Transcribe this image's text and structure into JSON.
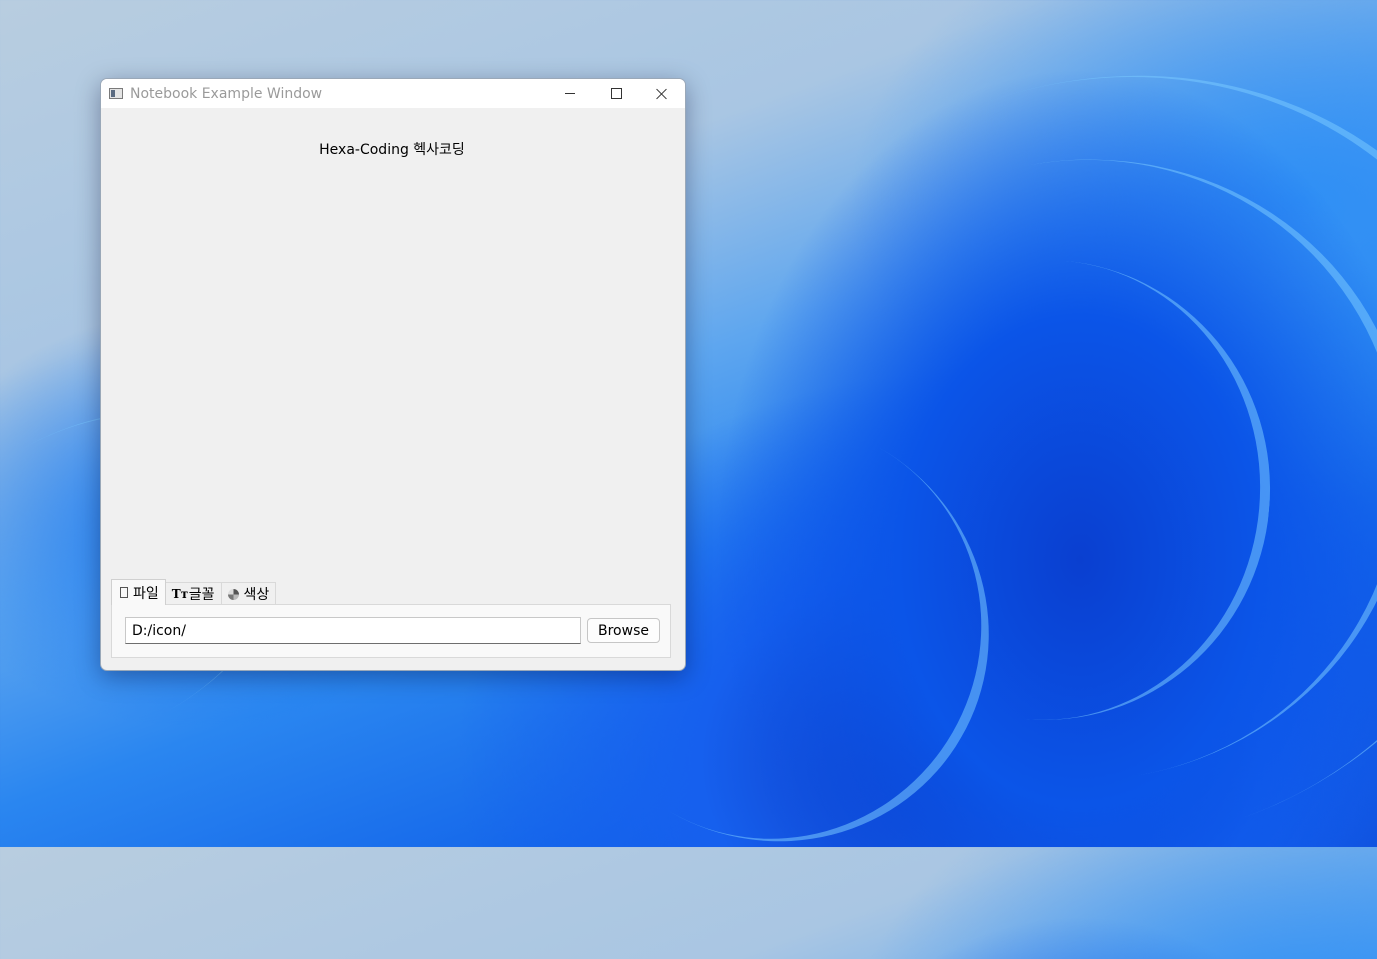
{
  "window": {
    "title": "Notebook Example Window",
    "heading": "Hexa-Coding 헥사코딩"
  },
  "tabs": [
    {
      "label": "파일",
      "icon": "file-icon",
      "active": true
    },
    {
      "label": "글꼴",
      "icon": "font-icon",
      "active": false
    },
    {
      "label": "색상",
      "icon": "palette-icon",
      "active": false
    }
  ],
  "file_tab": {
    "path_value": "D:/icon/",
    "browse_label": "Browse"
  },
  "colors": {
    "window_bg": "#f0f0f0",
    "titlebar_bg": "#ffffff",
    "wallpaper_accent": "#1466ea"
  }
}
